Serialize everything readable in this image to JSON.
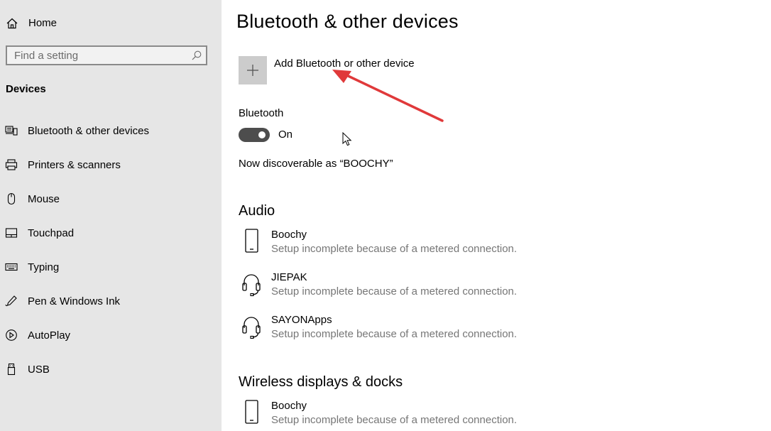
{
  "sidebar": {
    "home_label": "Home",
    "search_placeholder": "Find a setting",
    "section_title": "Devices",
    "items": [
      {
        "label": "Bluetooth & other devices",
        "icon": "bluetooth-devices-icon"
      },
      {
        "label": "Printers & scanners",
        "icon": "printer-icon"
      },
      {
        "label": "Mouse",
        "icon": "mouse-icon"
      },
      {
        "label": "Touchpad",
        "icon": "touchpad-icon"
      },
      {
        "label": "Typing",
        "icon": "keyboard-icon"
      },
      {
        "label": "Pen & Windows Ink",
        "icon": "pen-icon"
      },
      {
        "label": "AutoPlay",
        "icon": "autoplay-icon"
      },
      {
        "label": "USB",
        "icon": "usb-icon"
      }
    ]
  },
  "main": {
    "title": "Bluetooth & other devices",
    "add_device_label": "Add Bluetooth or other device",
    "bluetooth_heading": "Bluetooth",
    "bluetooth_state": "On",
    "discoverable_text": "Now discoverable as “BOOCHY”",
    "audio": {
      "title": "Audio",
      "devices": [
        {
          "name": "Boochy",
          "status": "Setup incomplete because of a metered connection.",
          "icon": "phone-icon"
        },
        {
          "name": "JIEPAK",
          "status": "Setup incomplete because of a metered connection.",
          "icon": "headset-icon"
        },
        {
          "name": "SAYONApps",
          "status": "Setup incomplete because of a metered connection.",
          "icon": "headset-icon"
        }
      ]
    },
    "wireless": {
      "title": "Wireless displays & docks",
      "devices": [
        {
          "name": "Boochy",
          "status": "Setup incomplete because of a metered connection.",
          "icon": "phone-icon"
        }
      ]
    }
  },
  "colors": {
    "sidebar_bg": "#e6e6e6",
    "toggle_on": "#4d4d4d",
    "add_button_bg": "#cccccc",
    "secondary_text": "#767676",
    "annotation_arrow": "#e0393a"
  }
}
